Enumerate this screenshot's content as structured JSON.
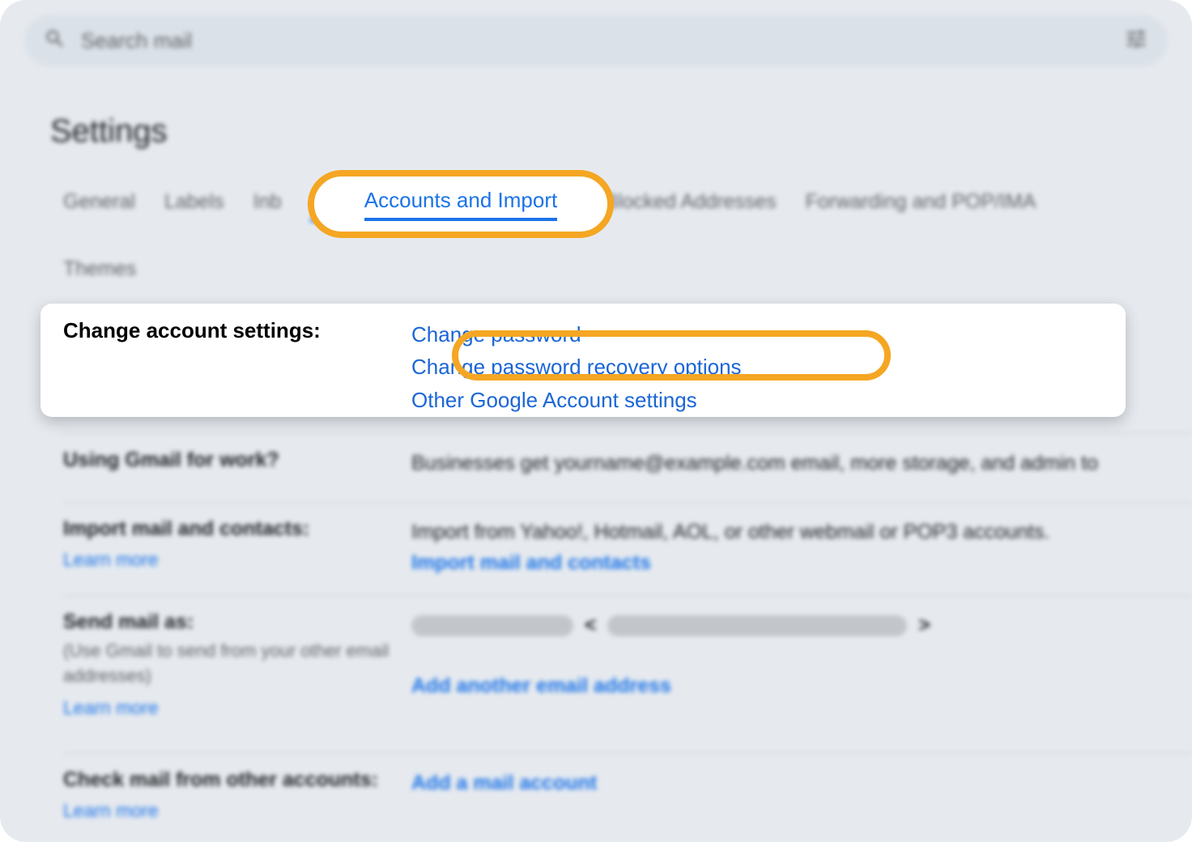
{
  "search": {
    "placeholder": "Search mail"
  },
  "page_title": "Settings",
  "tabs": {
    "general": "General",
    "labels": "Labels",
    "inbox": "Inb",
    "accounts_import": "Accounts and Import",
    "filters": "ters and Blocked Addresses",
    "forwarding": "Forwarding and POP/IMA",
    "themes": "Themes"
  },
  "rows": {
    "change_account": {
      "label": "Change account settings:",
      "change_password": "Change password",
      "recovery": "Change password recovery options",
      "other": "Other Google Account settings"
    },
    "work": {
      "label": "Using Gmail for work?",
      "text": "Businesses get yourname@example.com email, more storage, and admin to"
    },
    "import": {
      "label": "Import mail and contacts:",
      "learn": "Learn more",
      "text": "Import from Yahoo!, Hotmail, AOL, or other webmail or POP3 accounts.",
      "link": "Import mail and contacts"
    },
    "send_as": {
      "label": "Send mail as:",
      "sublabel": "(Use Gmail to send from your other email addresses)",
      "learn": "Learn more",
      "link": "Add another email address"
    },
    "check_mail": {
      "label": "Check mail from other accounts:",
      "learn": "Learn more",
      "link": "Add a mail account"
    }
  }
}
